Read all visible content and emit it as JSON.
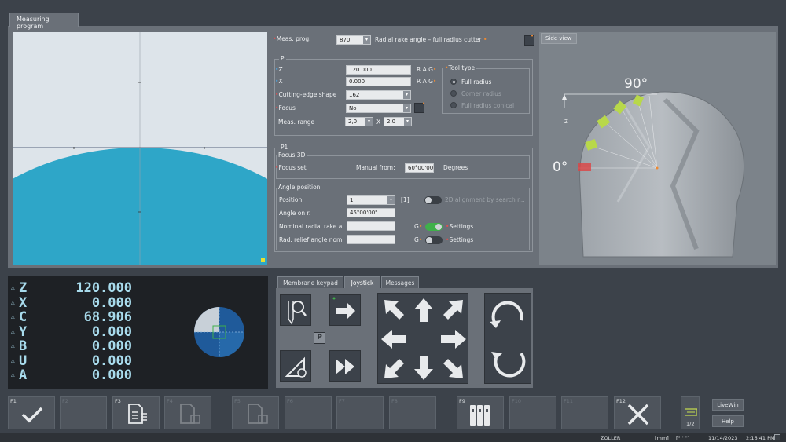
{
  "window": {
    "tab_title": "Measuring program"
  },
  "form": {
    "meas_prog_label": "Meas. prog.",
    "meas_prog_value": "870",
    "meas_prog_desc": "Radial rake angle – full radius cutter",
    "p_group": "P",
    "z_label": "Z",
    "z_value": "120.000",
    "x_label": "X",
    "x_value": "0.000",
    "rag1": "R A G",
    "rag2": "R A G",
    "cutting_edge_label": "Cutting-edge shape",
    "cutting_edge_value": "162",
    "focus_label": "Focus",
    "focus_value": "No",
    "meas_range_label": "Meas. range",
    "meas_range_a": "2,0",
    "meas_range_x": "X",
    "meas_range_b": "2,0",
    "tool_type_title": "Tool type",
    "tool_types": [
      "Full radius",
      "Corner radius",
      "Full radius conical"
    ],
    "p1_group": "P1",
    "focus3d_title": "Focus 3D",
    "focus_set_label": "Focus set",
    "manual_from_label": "Manual from:",
    "manual_from_value": "60°00'00",
    "degrees_label": "Degrees",
    "angle_position_title": "Angle position",
    "position_label": "Position",
    "position_value": "1",
    "position_bracket": "[1]",
    "alignment_label": "2D alignment by search r...",
    "angle_on_label": "Angle on r.",
    "angle_on_value": "45°00'00\"",
    "nominal_label": "Nominal radial rake a...",
    "rad_relief_label": "Rad. relief angle nom.",
    "g1": "G",
    "g2": "G",
    "settings1": "Settings",
    "settings2": "Settings"
  },
  "side_view": {
    "tab": "Side view",
    "angle_90": "90°",
    "angle_0": "0°",
    "z_axis": "Z"
  },
  "dro": {
    "axes": [
      {
        "axis": "Z",
        "value": "120.000"
      },
      {
        "axis": "X",
        "value": "0.000"
      },
      {
        "axis": "C",
        "value": "68.906"
      },
      {
        "axis": "Y",
        "value": "0.000"
      },
      {
        "axis": "B",
        "value": "0.000"
      },
      {
        "axis": "U",
        "value": "0.000"
      },
      {
        "axis": "A",
        "value": "0.000"
      }
    ]
  },
  "joystick": {
    "tabs": [
      "Membrane keypad",
      "Joystick",
      "Messages"
    ],
    "active_tab": "Joystick",
    "p_label": "P"
  },
  "fkeys": [
    {
      "label": "F1",
      "enabled": true,
      "icon": "check-icon"
    },
    {
      "label": "F2",
      "enabled": false,
      "icon": ""
    },
    {
      "label": "F3",
      "enabled": true,
      "icon": "document-list-icon"
    },
    {
      "label": "F4",
      "enabled": false,
      "icon": "document-stack-icon"
    },
    {
      "label": "F5",
      "enabled": false,
      "icon": "document-list-icon"
    },
    {
      "label": "F6",
      "enabled": false,
      "icon": ""
    },
    {
      "label": "F7",
      "enabled": false,
      "icon": ""
    },
    {
      "label": "F8",
      "enabled": false,
      "icon": ""
    },
    {
      "label": "F9",
      "enabled": true,
      "icon": "binders-icon"
    },
    {
      "label": "F10",
      "enabled": false,
      "icon": ""
    },
    {
      "label": "F11",
      "enabled": false,
      "icon": ""
    },
    {
      "label": "F12",
      "enabled": true,
      "icon": "close-icon"
    }
  ],
  "page_indicator": "1/2",
  "livewin_label": "LiveWin",
  "help_label": "Help",
  "status": {
    "company": "ZOLLER",
    "unit": "[mm]",
    "angle_unit": "[° ' \"]",
    "date": "11/14/2023",
    "time": "2:16:41 PM"
  },
  "colors": {
    "accent_green": "#3fb04a",
    "cyan_fill": "#2ea6c8",
    "status_yellow": "#d8c23a",
    "required_red": "#e05050"
  }
}
